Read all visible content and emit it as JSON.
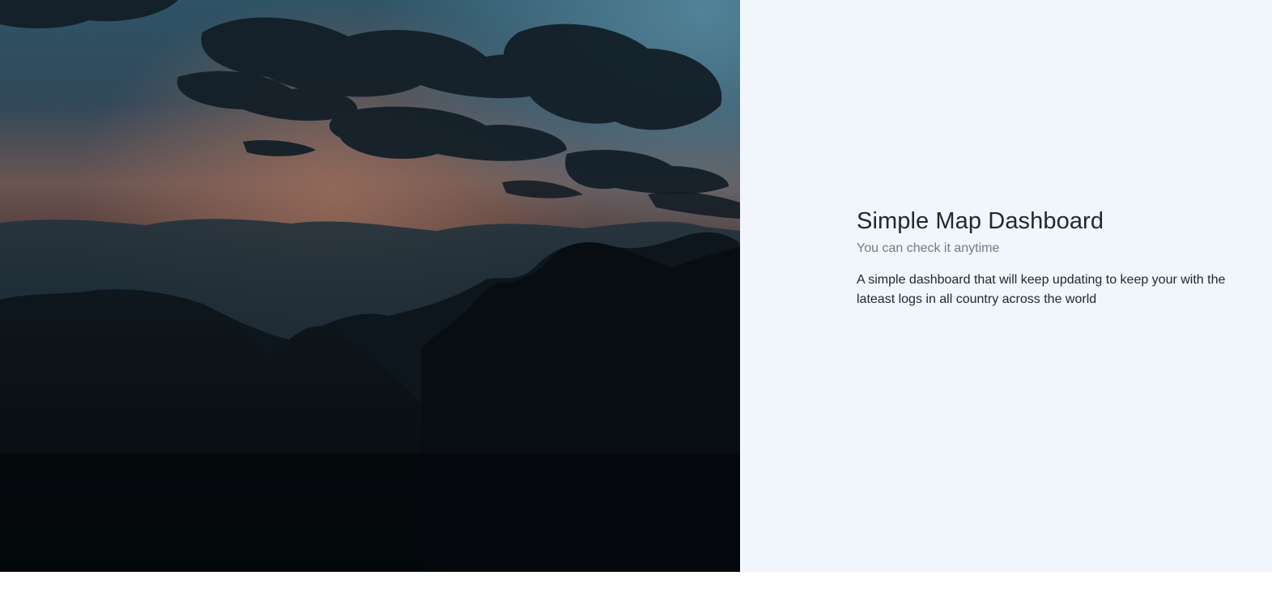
{
  "hero": {
    "image_name": "mountain-sunset-landscape",
    "colors": {
      "sky_top": "#2d5466",
      "sky_glow": "#8b5f52",
      "cloud": "#14222b",
      "mountain": "#0a1218"
    }
  },
  "intro": {
    "title": "Simple Map Dashboard",
    "subtitle": "You can check it anytime",
    "description": "A simple dashboard that will keep updating to keep your with the lateast logs in all country across the world"
  },
  "colors": {
    "panel_background": "#f1f5fc",
    "title": "#222831",
    "subtitle": "#737b84",
    "body_text": "#23282e"
  }
}
